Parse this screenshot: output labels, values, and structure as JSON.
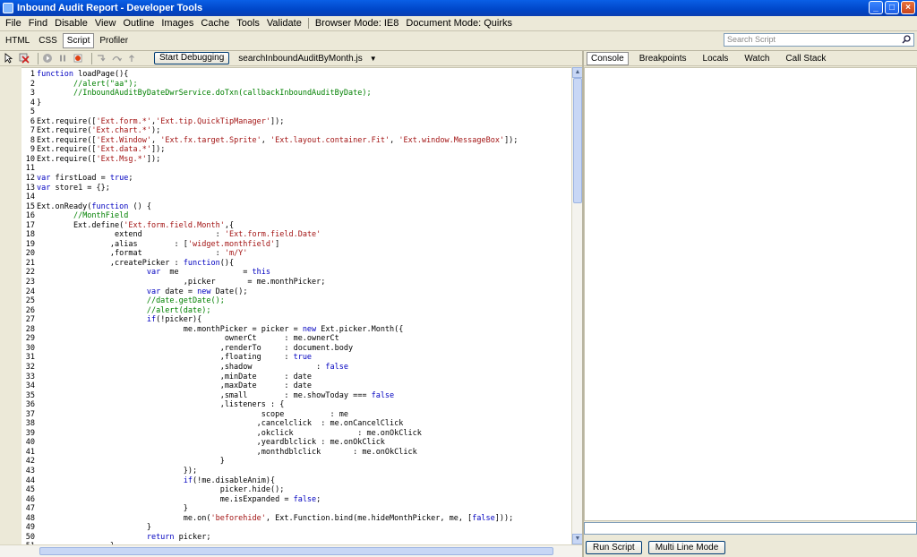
{
  "window": {
    "title": "Inbound Audit Report - Developer Tools",
    "min_label": "_",
    "max_label": "□",
    "close_label": "×"
  },
  "menu": {
    "items": [
      "File",
      "Find",
      "Disable",
      "View",
      "Outline",
      "Images",
      "Cache",
      "Tools",
      "Validate"
    ],
    "browser_mode": "Browser Mode: IE8",
    "document_mode": "Document Mode: Quirks"
  },
  "tabs": {
    "items": [
      "HTML",
      "CSS",
      "Script",
      "Profiler"
    ],
    "active": "Script"
  },
  "search": {
    "placeholder": "Search Script"
  },
  "toolbar": {
    "start_debugging": "Start Debugging",
    "file": "searchInboundAuditByMonth.js",
    "file_caret": "▼"
  },
  "right_tabs": [
    "Console",
    "Breakpoints",
    "Locals",
    "Watch",
    "Call Stack"
  ],
  "bottom": {
    "run_script": "Run Script",
    "multi_line": "Multi Line Mode"
  },
  "code_lines": [
    "function loadPage(){",
    "        //alert(\"aa\");",
    "        //InboundAuditByDateDwrService.doTxn(callbackInboundAuditByDate);",
    "}",
    "",
    "Ext.require(['Ext.form.*','Ext.tip.QuickTipManager']);",
    "Ext.require('Ext.chart.*');",
    "Ext.require(['Ext.Window', 'Ext.fx.target.Sprite', 'Ext.layout.container.Fit', 'Ext.window.MessageBox']);",
    "Ext.require(['Ext.data.*']);",
    "Ext.require(['Ext.Msg.*']);",
    "",
    "var firstLoad = true;",
    "var store1 = {};",
    "",
    "Ext.onReady(function () {",
    "        //MonthField",
    "        Ext.define('Ext.form.field.Month',{",
    "                 extend                : 'Ext.form.field.Date'",
    "                ,alias        : ['widget.monthfield']",
    "                ,format                : 'm/Y'",
    "                ,createPicker : function(){",
    "                        var  me              = this",
    "                                ,picker       = me.monthPicker;",
    "                        var date = new Date();",
    "                        //date.getDate();",
    "                        //alert(date);",
    "                        if(!picker){",
    "                                me.monthPicker = picker = new Ext.picker.Month({",
    "                                         ownerCt      : me.ownerCt",
    "                                        ,renderTo     : document.body",
    "                                        ,floating     : true",
    "                                        ,shadow              : false",
    "                                        ,minDate      : date",
    "                                        ,maxDate      : date",
    "                                        ,small        : me.showToday === false",
    "                                        ,listeners : {",
    "                                                 scope          : me",
    "                                                ,cancelclick  : me.onCancelClick",
    "                                                ,okclick              : me.onOkClick",
    "                                                ,yeardblclick : me.onOkClick",
    "                                                ,monthdblclick       : me.onOkClick",
    "                                        }",
    "                                });",
    "                                if(!me.disableAnim){",
    "                                        picker.hide();",
    "                                        me.isExpanded = false;",
    "                                }",
    "                                me.on('beforehide', Ext.Function.bind(me.hideMonthPicker, me, [false]));",
    "                        }",
    "                        return picker;",
    "                }"
  ]
}
